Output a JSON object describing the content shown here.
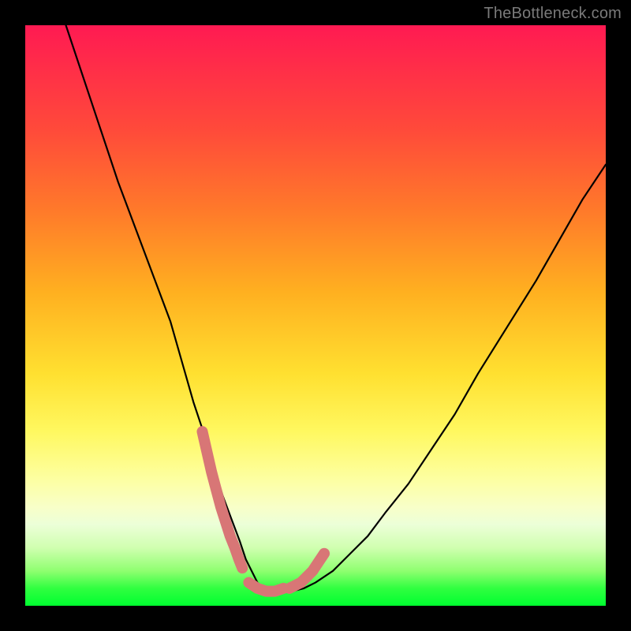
{
  "watermark": "TheBottleneck.com",
  "colors": {
    "background": "#000000",
    "curve_main": "#000000",
    "curve_accent": "#d87676",
    "gradient_top": "#ff1a52",
    "gradient_bottom": "#00ff30"
  },
  "chart_data": {
    "type": "line",
    "title": "",
    "xlabel": "",
    "ylabel": "",
    "xlim": [
      0,
      100
    ],
    "ylim": [
      0,
      100
    ],
    "series": [
      {
        "name": "bottleneck-curve",
        "x": [
          7,
          10,
          13,
          16,
          19,
          22,
          25,
          27,
          29,
          31,
          32.5,
          34,
          35.5,
          37,
          38,
          39,
          40,
          41,
          42.5,
          44,
          46,
          48,
          50,
          53,
          56,
          59,
          62,
          66,
          70,
          74,
          78,
          83,
          88,
          92,
          96,
          100
        ],
        "y": [
          100,
          91,
          82,
          73,
          65,
          57,
          49,
          42,
          35,
          29,
          24,
          19,
          15,
          11,
          8,
          6,
          4,
          3,
          2.5,
          2.5,
          2.5,
          3,
          4,
          6,
          9,
          12,
          16,
          21,
          27,
          33,
          40,
          48,
          56,
          63,
          70,
          76
        ]
      }
    ],
    "accent_segments": [
      {
        "name": "left-descent-accent",
        "x": [
          30.5,
          31.3,
          32.1,
          32.9,
          33.7,
          34.5,
          35.3,
          36.1,
          36.8,
          37.4
        ],
        "y": [
          30,
          26.5,
          23,
          20,
          17,
          14.5,
          12,
          10,
          8,
          6.5
        ]
      },
      {
        "name": "right-ascent-accent",
        "x": [
          45.5,
          46.5,
          47.5,
          48.5,
          49.5,
          50.5,
          51.5
        ],
        "y": [
          3,
          3.5,
          4,
          5,
          6,
          7.5,
          9
        ]
      },
      {
        "name": "valley-floor-accent",
        "x": [
          38.5,
          40,
          41.5,
          43,
          44.5
        ],
        "y": [
          4,
          3,
          2.5,
          2.5,
          3
        ]
      }
    ]
  }
}
